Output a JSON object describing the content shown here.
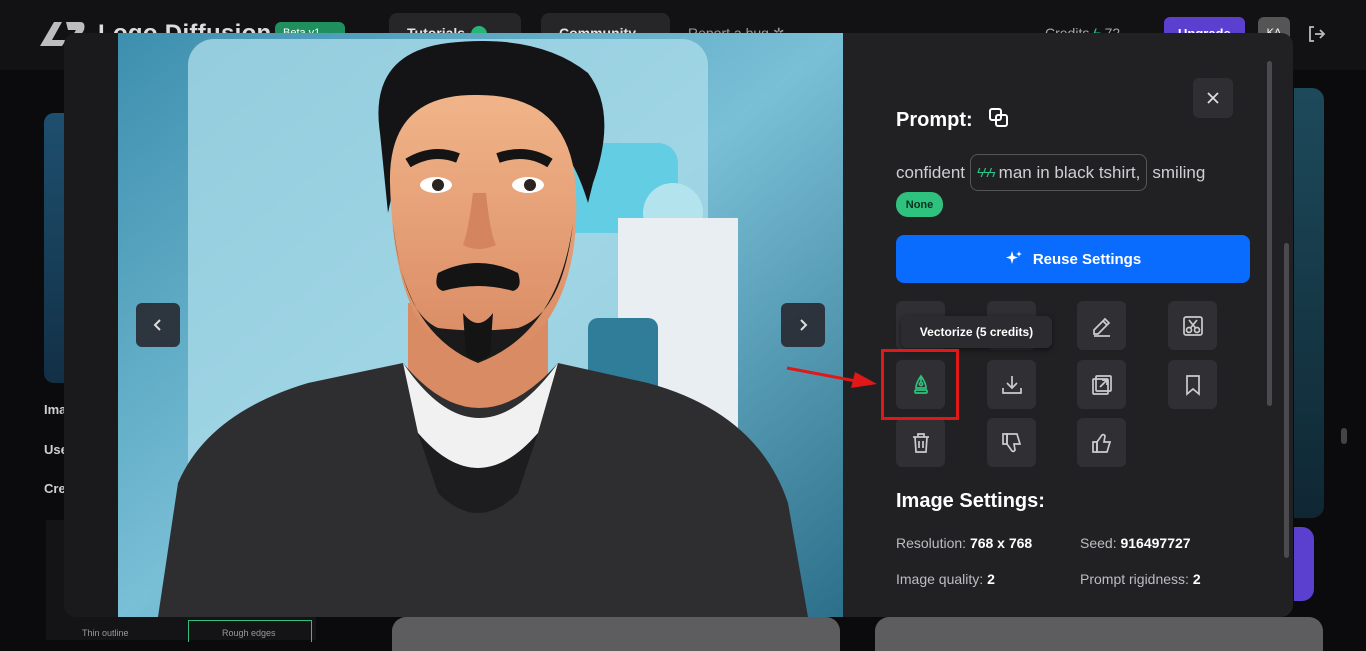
{
  "header": {
    "brand": "Logo Diffusion",
    "badge": "Beta v1",
    "nav": [
      {
        "label": "Tutorials"
      },
      {
        "label": "Community"
      }
    ],
    "report_bug": "Report a bug",
    "credits_label": "Credits",
    "credits_value": "72",
    "upgrade_label": "Upgrade",
    "avatar_initials": "KA"
  },
  "background": {
    "side_labels": [
      "Ima",
      "Use",
      "Cre"
    ],
    "thumb_captions": [
      "Thin outline",
      "Rough edges"
    ]
  },
  "modal": {
    "prompt": {
      "title": "Prompt:",
      "before": "confident",
      "chip_bolts": "ϟϟϟ",
      "chip_text": "man in black tshirt,",
      "after": "smiling",
      "style_badge": "None"
    },
    "reuse_button": "Reuse Settings",
    "tooltip": "Vectorize (5 credits)",
    "tools": [
      {
        "name": "tool-1",
        "icon": "hidden-icon"
      },
      {
        "name": "tool-2",
        "icon": "hidden-icon"
      },
      {
        "name": "edit",
        "icon": "pencil-icon"
      },
      {
        "name": "remove-background",
        "icon": "cut-icon"
      },
      {
        "name": "vectorize",
        "icon": "pen-nib-icon"
      },
      {
        "name": "download",
        "icon": "download-icon"
      },
      {
        "name": "upscale",
        "icon": "expand-icon"
      },
      {
        "name": "bookmark",
        "icon": "bookmark-icon"
      },
      {
        "name": "delete",
        "icon": "trash-icon"
      },
      {
        "name": "dislike",
        "icon": "thumbs-down-icon"
      },
      {
        "name": "like",
        "icon": "thumbs-up-icon"
      }
    ],
    "image_settings": {
      "title": "Image Settings:",
      "resolution_label": "Resolution:",
      "resolution_value": "768 x 768",
      "seed_label": "Seed:",
      "seed_value": "916497727",
      "quality_label": "Image quality:",
      "quality_value": "2",
      "rigidness_label": "Prompt rigidness:",
      "rigidness_value": "2"
    }
  },
  "colors": {
    "accent_blue": "#0a6cff",
    "accent_green": "#2ec27e",
    "highlight_red": "#e01818",
    "upgrade_purple": "#5b3fcf"
  }
}
